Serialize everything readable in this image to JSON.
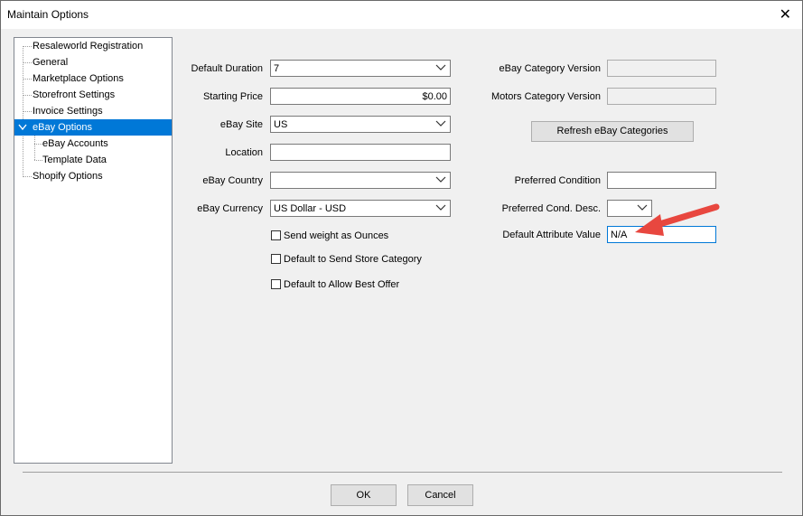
{
  "window": {
    "title": "Maintain Options",
    "close_glyph": "✕"
  },
  "tree": {
    "items": [
      {
        "label": "Resaleworld Registration"
      },
      {
        "label": "General"
      },
      {
        "label": "Marketplace Options"
      },
      {
        "label": "Storefront Settings"
      },
      {
        "label": "Invoice Settings"
      },
      {
        "label": "eBay Options"
      },
      {
        "label": "eBay Accounts"
      },
      {
        "label": "Template Data"
      },
      {
        "label": "Shopify Options"
      }
    ],
    "selected": "eBay Options"
  },
  "form": {
    "default_duration": {
      "label": "Default Duration",
      "value": "7"
    },
    "starting_price": {
      "label": "Starting Price",
      "value": "$0.00"
    },
    "ebay_site": {
      "label": "eBay Site",
      "value": "US"
    },
    "location": {
      "label": "Location",
      "value": ""
    },
    "ebay_country": {
      "label": "eBay Country",
      "value": ""
    },
    "ebay_currency": {
      "label": "eBay Currency",
      "value": "US Dollar - USD"
    },
    "checkboxes": [
      {
        "label": "Send weight as Ounces",
        "checked": false
      },
      {
        "label": "Default to Send Store Category",
        "checked": false
      },
      {
        "label": "Default to Allow Best Offer",
        "checked": false
      }
    ],
    "ebay_category_version": {
      "label": "eBay Category Version",
      "value": ""
    },
    "motors_category_version": {
      "label": "Motors Category Version",
      "value": ""
    },
    "refresh_button": "Refresh eBay Categories",
    "preferred_condition": {
      "label": "Preferred Condition",
      "value": ""
    },
    "preferred_cond_desc": {
      "label": "Preferred Cond. Desc.",
      "value": ""
    },
    "default_attribute_value": {
      "label": "Default Attribute Value",
      "value": "N/A"
    }
  },
  "footer": {
    "ok_label": "OK",
    "cancel_label": "Cancel"
  },
  "colors": {
    "selection": "#0078d7",
    "arrow": "#e8473f"
  }
}
